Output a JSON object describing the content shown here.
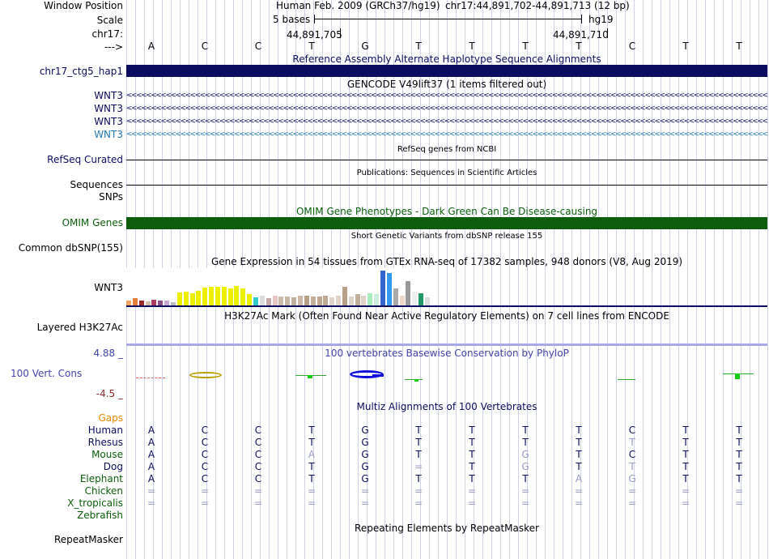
{
  "header": {
    "window_position_label": "Window Position",
    "assembly_text": "Human Feb. 2009 (GRCh37/hg19)",
    "position_text": "chr17:44,891,702-44,891,713 (12 bp)",
    "scale_label": "Scale",
    "scale_bar_text": "5 bases",
    "scale_db": "hg19",
    "chrom_label": "chr17:",
    "coord_left": "44,891,705",
    "coord_right": "44,891,710",
    "strand_label": "--->"
  },
  "reference_bases": [
    "A",
    "C",
    "C",
    "T",
    "G",
    "T",
    "T",
    "T",
    "T",
    "C",
    "T",
    "T"
  ],
  "tracks": {
    "alt_haplotype": {
      "title": "Reference Assembly Alternate Haplotype Sequence Alignments",
      "label": "chr17_ctg5_hap1",
      "color": "#0b0c5f"
    },
    "gencode": {
      "title": "GENCODE V49lift37 (1 items filtered out)",
      "labels": [
        "WNT3",
        "WNT3",
        "WNT3",
        "WNT3"
      ],
      "arrow_glyph": "<",
      "colors": [
        "#0b0c5f",
        "#0b0c5f",
        "#0b0c5f",
        "#1f77b4"
      ]
    },
    "refseq": {
      "title": "RefSeq genes from NCBI",
      "label": "RefSeq Curated"
    },
    "publications": {
      "title": "Publications: Sequences in Scientific Articles",
      "label": "Sequences"
    },
    "snps": {
      "label": "SNPs"
    },
    "omim": {
      "title": "OMIM Gene Phenotypes - Dark Green Can Be Disease-causing",
      "label": "OMIM Genes",
      "color": "#0c5d0c"
    },
    "dbsnp": {
      "title": "Short Genetic Variants from dbSNP release 155",
      "label": "Common dbSNP(155)"
    },
    "gtex": {
      "title": "Gene Expression in 54 tissues from GTEx RNA-seq of 17382 samples, 948 donors (V8, Aug 2019)",
      "label": "WNT3",
      "bars": [
        {
          "level": 0.14,
          "color": "#f4a460"
        },
        {
          "level": 0.19,
          "color": "#e57e3d"
        },
        {
          "level": 0.12,
          "color": "#9b2b2b"
        },
        {
          "level": 0.1,
          "color": "#d4bfa9"
        },
        {
          "level": 0.16,
          "color": "#b03a5b"
        },
        {
          "level": 0.13,
          "color": "#8c4d86"
        },
        {
          "level": 0.12,
          "color": "#c7a6d6"
        },
        {
          "level": 0.09,
          "color": "#bbbbbb"
        },
        {
          "level": 0.35,
          "color": "#eeee00"
        },
        {
          "level": 0.37,
          "color": "#eeee00"
        },
        {
          "level": 0.33,
          "color": "#eeee00"
        },
        {
          "level": 0.4,
          "color": "#eeee00"
        },
        {
          "level": 0.47,
          "color": "#eeee00"
        },
        {
          "level": 0.49,
          "color": "#eeee00"
        },
        {
          "level": 0.51,
          "color": "#eeee00"
        },
        {
          "level": 0.51,
          "color": "#eeee00"
        },
        {
          "level": 0.45,
          "color": "#eeee00"
        },
        {
          "level": 0.52,
          "color": "#eeee00"
        },
        {
          "level": 0.45,
          "color": "#eeee00"
        },
        {
          "level": 0.3,
          "color": "#eeee00"
        },
        {
          "level": 0.22,
          "color": "#33cccc"
        },
        {
          "level": 0.26,
          "color": "#dddddd"
        },
        {
          "level": 0.2,
          "color": "#c5a8a8"
        },
        {
          "level": 0.26,
          "color": "#e6c4c4"
        },
        {
          "level": 0.24,
          "color": "#ccbbaa"
        },
        {
          "level": 0.24,
          "color": "#c9b7a5"
        },
        {
          "level": 0.22,
          "color": "#c0b0a0"
        },
        {
          "level": 0.25,
          "color": "#cab7a5"
        },
        {
          "level": 0.26,
          "color": "#b89f87"
        },
        {
          "level": 0.24,
          "color": "#c2ae99"
        },
        {
          "level": 0.24,
          "color": "#bca690"
        },
        {
          "level": 0.25,
          "color": "#c0aa94"
        },
        {
          "level": 0.22,
          "color": "#e0d4c8"
        },
        {
          "level": 0.26,
          "color": "#e0d4c8"
        },
        {
          "level": 0.5,
          "color": "#b89f87"
        },
        {
          "level": 0.24,
          "color": "#e0d4c8"
        },
        {
          "level": 0.3,
          "color": "#c2ae99"
        },
        {
          "level": 0.26,
          "color": "#e0d4c8"
        },
        {
          "level": 0.33,
          "color": "#aaeebb"
        },
        {
          "level": 0.3,
          "color": "#cceedd"
        },
        {
          "level": 0.93,
          "color": "#3366cc"
        },
        {
          "level": 0.88,
          "color": "#3399ee"
        },
        {
          "level": 0.46,
          "color": "#aaaaaa"
        },
        {
          "level": 0.26,
          "color": "#f0d8c8"
        },
        {
          "level": 0.65,
          "color": "#999999"
        },
        {
          "level": 0.38,
          "color": "#eeeeee"
        },
        {
          "level": 0.33,
          "color": "#229966"
        },
        {
          "level": 0.21,
          "color": "#dddddd"
        }
      ]
    },
    "h3k27ac": {
      "title": "H3K27Ac Mark (Often Found Near Active Regulatory Elements) on 7 cell lines from ENCODE",
      "label": "Layered H3K27Ac"
    },
    "phylop": {
      "title": "100 vertebrates Basewise Conservation by PhyloP",
      "label": "100 Vert. Cons",
      "max_label": "4.88 _",
      "min_label": "-4.5 _"
    },
    "multiz": {
      "title": "Multiz Alignments of 100 Vertebrates",
      "gaps_label": "Gaps",
      "species": [
        {
          "name": "Human",
          "color": "#0b0c5f",
          "bases": [
            "A",
            "C",
            "C",
            "T",
            "G",
            "T",
            "T",
            "T",
            "T",
            "C",
            "T",
            "T"
          ]
        },
        {
          "name": "Rhesus",
          "color": "#0b0c5f",
          "bases": [
            "A",
            "C",
            "C",
            "T",
            "G",
            "T",
            "T",
            "T",
            "T",
            "T",
            "T",
            "T"
          ]
        },
        {
          "name": "Mouse",
          "color": "#0c5d0c",
          "bases": [
            "A",
            "C",
            "C",
            "A",
            "G",
            "T",
            "T",
            "G",
            "T",
            "C",
            "T",
            "T"
          ]
        },
        {
          "name": "Dog",
          "color": "#0b0c5f",
          "bases": [
            "A",
            "C",
            "C",
            "T",
            "G",
            "=",
            "T",
            "G",
            "T",
            "T",
            "T",
            "T"
          ]
        },
        {
          "name": "Elephant",
          "color": "#0c5d0c",
          "bases": [
            "A",
            "C",
            "C",
            "T",
            "G",
            "T",
            "T",
            "T",
            "A",
            "G",
            "T",
            "T"
          ]
        },
        {
          "name": "Chicken",
          "color": "#0c5d0c",
          "bases": [
            "=",
            "=",
            "=",
            "=",
            "=",
            "=",
            "=",
            "=",
            "=",
            "=",
            "=",
            "="
          ]
        },
        {
          "name": "X_tropicalis",
          "color": "#0c5d0c",
          "bases": [
            "=",
            "=",
            "=",
            "=",
            "=",
            "=",
            "=",
            "=",
            "=",
            "=",
            "=",
            "="
          ]
        },
        {
          "name": "Zebrafish",
          "color": "#0c5d0c",
          "bases": []
        }
      ],
      "light_cells": [
        [
          1,
          9
        ],
        [
          2,
          3
        ],
        [
          2,
          7
        ],
        [
          3,
          5
        ],
        [
          3,
          7
        ],
        [
          3,
          9
        ],
        [
          4,
          8
        ],
        [
          4,
          9
        ]
      ]
    },
    "repeatmasker": {
      "title": "Repeating Elements by RepeatMasker",
      "label": "RepeatMasker"
    }
  }
}
